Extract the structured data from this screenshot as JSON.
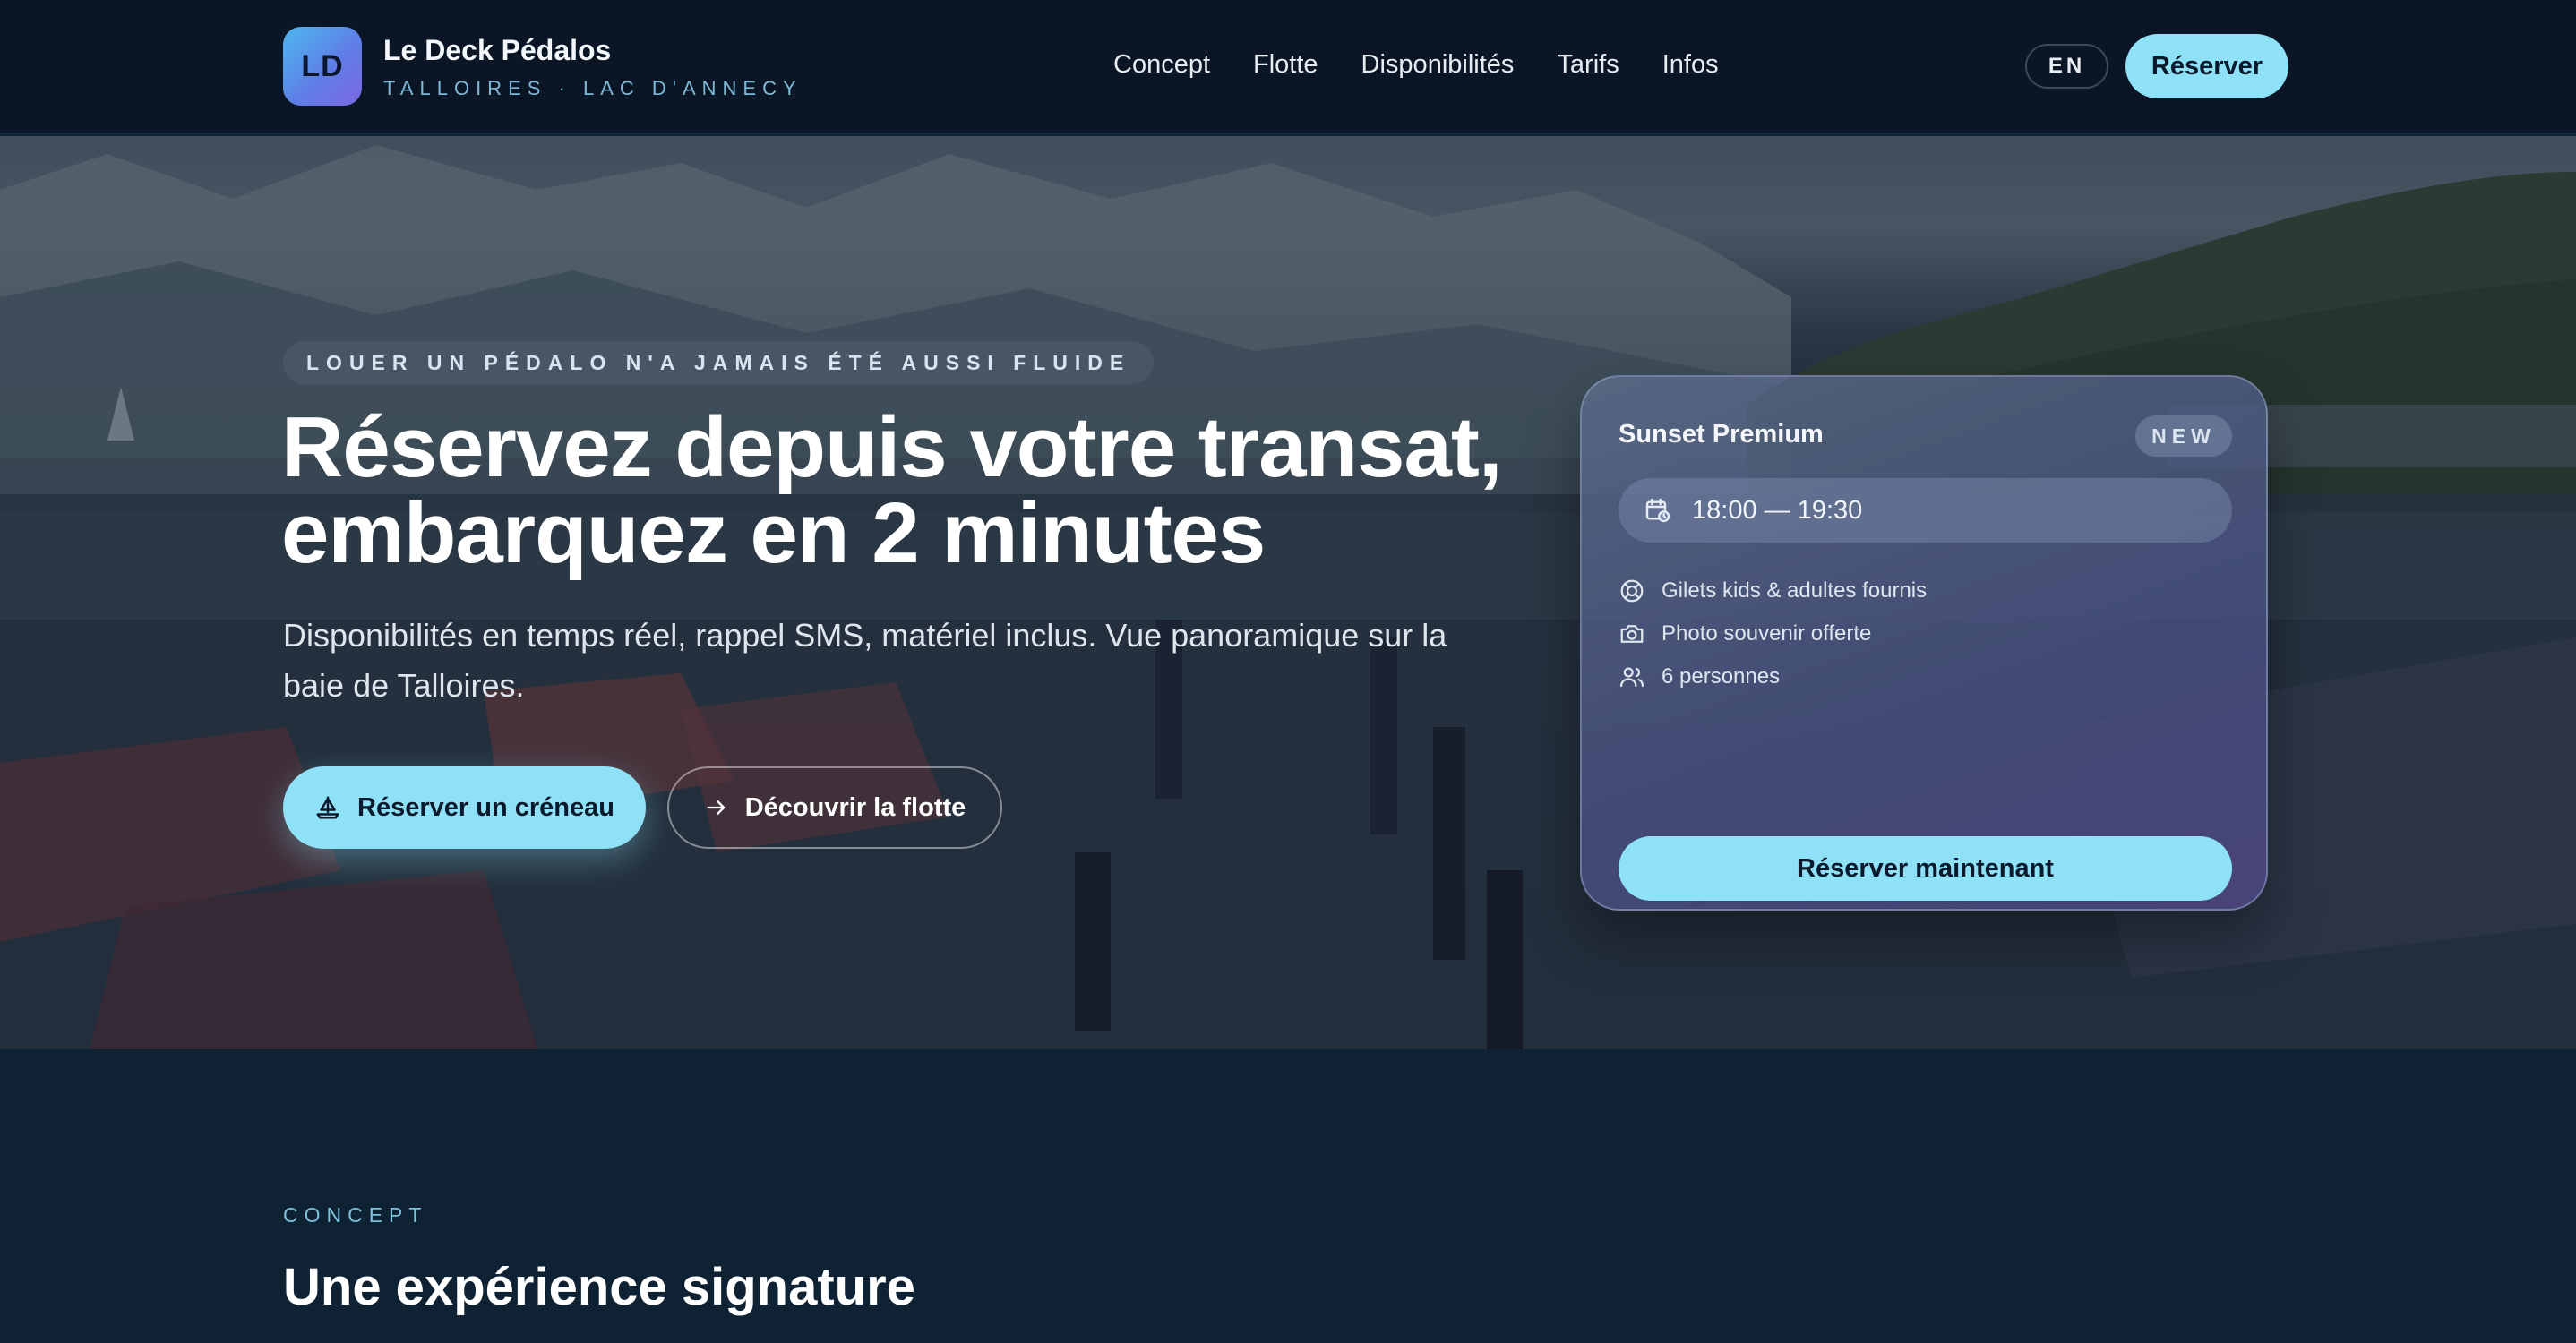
{
  "brand": {
    "logo_text": "LD",
    "name": "Le Deck Pédalos",
    "subtitle": "TALLOIRES · LAC D'ANNECY"
  },
  "nav": {
    "links": [
      "Concept",
      "Flotte",
      "Disponibilités",
      "Tarifs",
      "Infos"
    ],
    "lang": "EN",
    "cta": "Réserver"
  },
  "hero": {
    "eyebrow": "LOUER UN PÉDALO N'A JAMAIS ÉTÉ AUSSI FLUIDE",
    "title_line1": "Réservez depuis votre transat,",
    "title_line2": "embarquez en 2 minutes",
    "description": "Disponibilités en temps réel, rappel SMS, matériel inclus. Vue panoramique sur la baie de Talloires.",
    "primary_button": "Réserver un créneau",
    "secondary_button": "Découvrir la flotte"
  },
  "card": {
    "title": "Sunset Premium",
    "badge": "NEW",
    "time": "18:00 — 19:30",
    "features": [
      {
        "icon": "lifebuoy-icon",
        "label": "Gilets kids & adultes fournis"
      },
      {
        "icon": "camera-icon",
        "label": "Photo souvenir offerte"
      },
      {
        "icon": "users-icon",
        "label": "6 personnes"
      }
    ],
    "cta": "Réserver maintenant"
  },
  "concept": {
    "eyebrow": "CONCEPT",
    "title": "Une expérience signature"
  },
  "colors": {
    "accent": "#8fe1f7",
    "nav_bg": "#0a1526",
    "section_bg": "#0f2233"
  }
}
